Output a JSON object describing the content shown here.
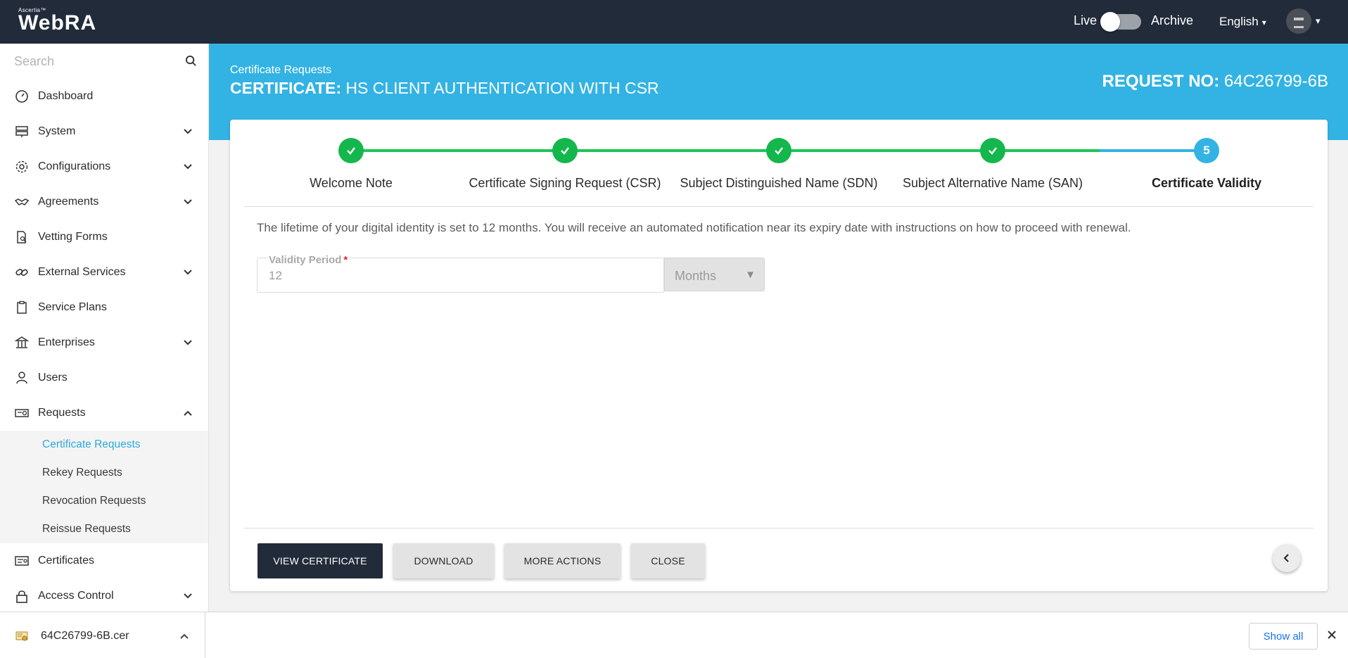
{
  "brand": {
    "small": "Ascertia™",
    "name": "WebRA"
  },
  "header": {
    "live_label": "Live",
    "archive_label": "Archive",
    "language": "English",
    "caret": "▾"
  },
  "search": {
    "placeholder": "Search"
  },
  "nav": {
    "items": [
      {
        "label": "Dashboard"
      },
      {
        "label": "System"
      },
      {
        "label": "Configurations"
      },
      {
        "label": "Agreements"
      },
      {
        "label": "Vetting Forms"
      },
      {
        "label": "External Services"
      },
      {
        "label": "Service Plans"
      },
      {
        "label": "Enterprises"
      },
      {
        "label": "Users"
      },
      {
        "label": "Requests"
      },
      {
        "label": "Certificates"
      },
      {
        "label": "Access Control"
      }
    ],
    "sub_items": [
      {
        "label": "Certificate Requests",
        "active": true
      },
      {
        "label": "Rekey Requests"
      },
      {
        "label": "Revocation Requests"
      },
      {
        "label": "Reissue Requests"
      }
    ]
  },
  "page": {
    "breadcrumb": "Certificate Requests",
    "title_prefix": "CERTIFICATE:",
    "title": "HS CLIENT AUTHENTICATION WITH CSR",
    "request_prefix": "REQUEST NO:",
    "request_no": "64C26799-6B"
  },
  "stepper": {
    "steps": [
      {
        "label": "Welcome Note",
        "status": "done"
      },
      {
        "label": "Certificate Signing Request (CSR)",
        "status": "done"
      },
      {
        "label": "Subject Distinguished Name (SDN)",
        "status": "done"
      },
      {
        "label": "Subject Alternative Name (SAN)",
        "status": "done"
      },
      {
        "label": "Certificate Validity",
        "status": "current",
        "number": "5"
      }
    ]
  },
  "validity": {
    "info": "The lifetime of your digital identity is set to 12 months. You will receive an automated notification near its expiry date with instructions on how to proceed with renewal.",
    "label": "Validity Period",
    "required_mark": "*",
    "value": "12",
    "unit": "Months"
  },
  "actions": {
    "view": "VIEW CERTIFICATE",
    "download": "DOWNLOAD",
    "more": "MORE ACTIONS",
    "close": "CLOSE"
  },
  "downloads": {
    "file_name": "64C26799-6B.cer",
    "show_all": "Show all"
  },
  "colors": {
    "topbar": "#222b3a",
    "hero": "#33b3e3",
    "step_done": "#14b74b",
    "step_current": "#33b3e3",
    "active_link": "#2eaadc"
  }
}
